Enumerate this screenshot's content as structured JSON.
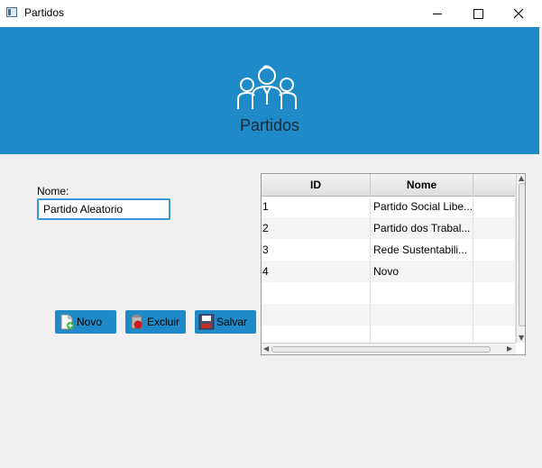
{
  "window": {
    "title": "Partidos",
    "minimize": "—",
    "maximize": "□",
    "close": "✕"
  },
  "header": {
    "title": "Partidos",
    "icon": "group-people-icon",
    "background": "#1f8ac8"
  },
  "form": {
    "nome_label": "Nome:",
    "nome_value": "Partido Aleatorio"
  },
  "buttons": {
    "novo": "Novo",
    "excluir": "Excluir",
    "salvar": "Salvar"
  },
  "table": {
    "columns": [
      "ID",
      "Nome",
      ""
    ],
    "rows": [
      {
        "id": "1",
        "nome": "Partido Social Libe..."
      },
      {
        "id": "2",
        "nome": "Partido dos Trabal..."
      },
      {
        "id": "3",
        "nome": "Rede Sustentabili..."
      },
      {
        "id": "4",
        "nome": "Novo"
      }
    ]
  }
}
